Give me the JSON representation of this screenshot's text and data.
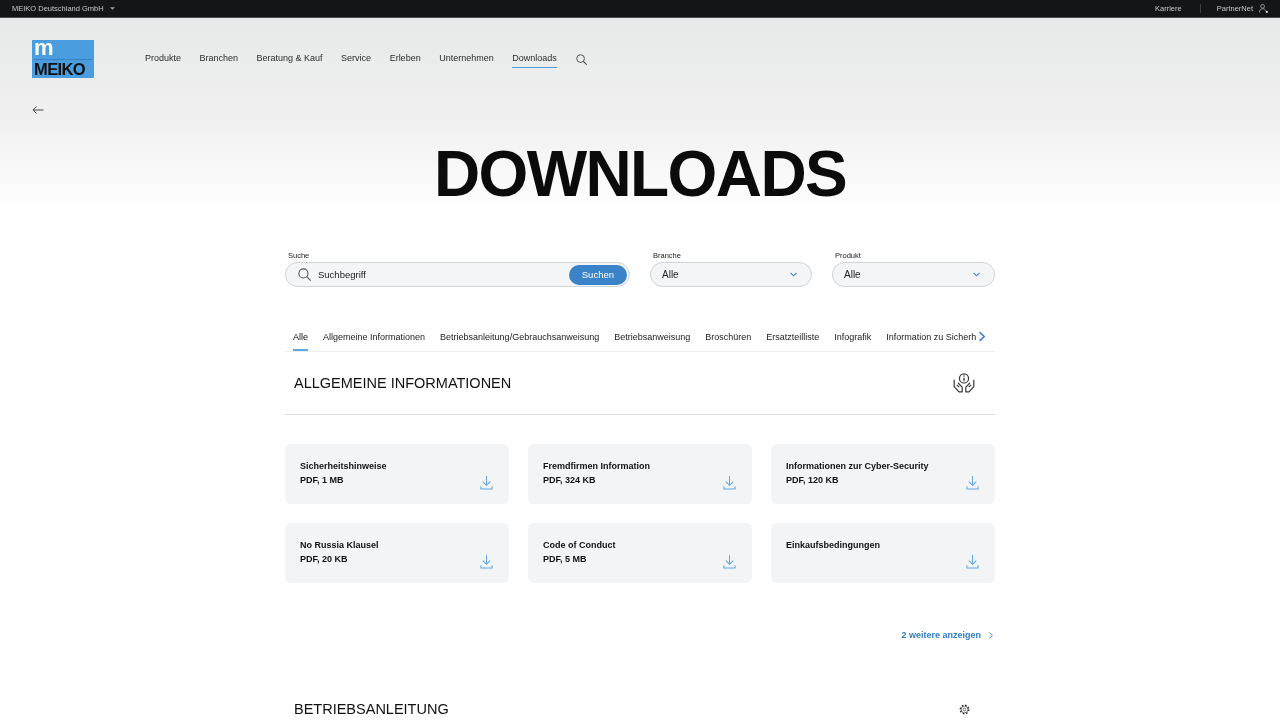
{
  "top_bar": {
    "company": "MEIKO Deutschland GmbH",
    "career_link": "Karriere",
    "partner_link": "PartnerNet"
  },
  "header": {
    "logo": {
      "mark": "m",
      "wordmark": "MEIKO"
    },
    "nav": [
      {
        "label": "Produkte",
        "selected": false
      },
      {
        "label": "Branchen",
        "selected": false
      },
      {
        "label": "Beratung & Kauf",
        "selected": false
      },
      {
        "label": "Service",
        "selected": false
      },
      {
        "label": "Erleben",
        "selected": false
      },
      {
        "label": "Unternehmen",
        "selected": false
      },
      {
        "label": "Downloads",
        "selected": true
      }
    ]
  },
  "page_title": "DOWNLOADS",
  "filters": {
    "search": {
      "label": "Suche",
      "placeholder": "Suchbegriff",
      "button": "Suchen"
    },
    "dropdowns": [
      {
        "label": "Branche",
        "value": "Alle"
      },
      {
        "label": "Produkt",
        "value": "Alle"
      }
    ]
  },
  "category_tabs": [
    {
      "label": "Alle",
      "selected": true
    },
    {
      "label": "Allgemeine Informationen",
      "selected": false
    },
    {
      "label": "Betriebsanleitung/Gebrauchsanweisung",
      "selected": false
    },
    {
      "label": "Betriebsanweisung",
      "selected": false
    },
    {
      "label": "Broschüren",
      "selected": false
    },
    {
      "label": "Ersatzteilliste",
      "selected": false
    },
    {
      "label": "Infografik",
      "selected": false
    },
    {
      "label": "Information zu Sicherh",
      "selected": false
    }
  ],
  "general_section": {
    "title": "ALLGEMEINE INFORMATIONEN",
    "documents": [
      {
        "title": "Sicherheitshinweise",
        "details": "PDF, 1 MB"
      },
      {
        "title": "Fremdfirmen Information",
        "details": "PDF, 324 KB"
      },
      {
        "title": "Informationen zur Cyber-Security",
        "details": "PDF, 120 KB"
      },
      {
        "title": "No Russia Klausel",
        "details": "PDF, 20 KB"
      },
      {
        "title": "Code of Conduct",
        "details": "PDF, 5 MB"
      },
      {
        "title": "Einkaufsbedingungen"
      }
    ],
    "more_link": "2 weitere anzeigen"
  },
  "next_section": {
    "title": "BETRIEBSANLEITUNG"
  }
}
